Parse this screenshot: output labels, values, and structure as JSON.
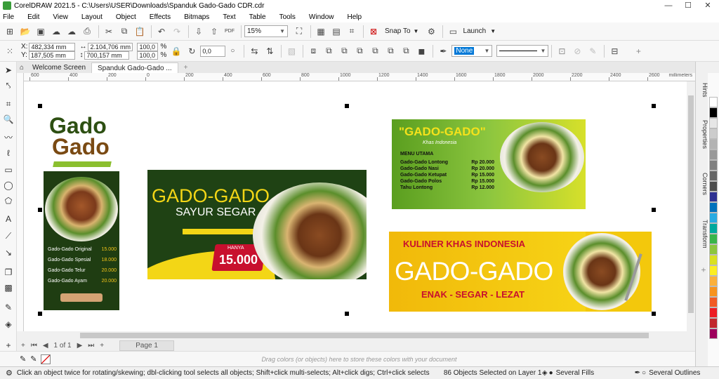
{
  "titlebar": {
    "title": "CorelDRAW 2021.5 - C:\\Users\\USER\\Downloads\\Spanduk Gado-Gado CDR.cdr",
    "min": "—",
    "max": "☐",
    "close": "✕"
  },
  "menu": [
    "File",
    "Edit",
    "View",
    "Layout",
    "Object",
    "Effects",
    "Bitmaps",
    "Text",
    "Table",
    "Tools",
    "Window",
    "Help"
  ],
  "toolbar": {
    "zoom": "15%",
    "snap_to": "Snap To",
    "launch": "Launch",
    "pdf": "PDF"
  },
  "propbar": {
    "x": "482,334 mm",
    "y": "187,505 mm",
    "w": "2.104,706 mm",
    "h": "700,157 mm",
    "scale_x": "100,0",
    "scale_y": "100,0",
    "pct": "%",
    "angle": "0,0",
    "outline": "None"
  },
  "tabs": {
    "welcome": "Welcome Screen",
    "doc": "Spanduk Gado-Gado ...",
    "add": "+"
  },
  "ruler": {
    "unit": "millimeters",
    "labels": [
      "600",
      "400",
      "200",
      "0",
      "200",
      "400",
      "600",
      "800",
      "1000",
      "1200",
      "1400",
      "1600",
      "1800",
      "2000",
      "2200",
      "2400",
      "2600"
    ]
  },
  "pagenav": {
    "count": "1 of 1",
    "page": "Page 1"
  },
  "colorstrip": {
    "hint": "Drag colors (or objects) here to store these colors with your document"
  },
  "status": {
    "hint": "Click an object twice for rotating/skewing; dbl-clicking tool selects all objects; Shift+click multi-selects; Alt+click digs; Ctrl+click selects in a group",
    "selection": "86 Objects Selected on Layer 1",
    "fill": "Several Fills",
    "outline": "Several Outlines"
  },
  "dock": {
    "hints": "Hints",
    "properties": "Properties",
    "corners": "Corners",
    "transform": "Transform"
  },
  "palette": [
    "#ffffff",
    "#000000",
    "#e6e6e6",
    "#cccccc",
    "#b3b3b3",
    "#999999",
    "#808080",
    "#666666",
    "#4d4d4d",
    "#2e3192",
    "#0071bc",
    "#29abe2",
    "#00a99d",
    "#39b54a",
    "#8cc63f",
    "#d9e021",
    "#fcee21",
    "#fbb03b",
    "#f7931e",
    "#f15a24",
    "#ed1c24",
    "#c1272d",
    "#9e005d"
  ],
  "banner1": {
    "title1": "Gado",
    "title2": "Gado",
    "menu": [
      {
        "name": "Gado-Gado Original",
        "price": "15.000"
      },
      {
        "name": "Gado-Gado Spesial",
        "price": "18.000"
      },
      {
        "name": "Gado-Gado Telur",
        "price": "20.000"
      },
      {
        "name": "Gado-Gado Ayam",
        "price": "20.000"
      }
    ]
  },
  "banner2": {
    "title": "GADO-GADO",
    "subtitle": "SAYUR SEGAR",
    "price_label": "HANYA",
    "price": "15.000"
  },
  "banner3": {
    "title": "\"GADO-GADO\"",
    "tagline": "Khas Indonesia",
    "menu_header": "MENU UTAMA",
    "menu": [
      {
        "name": "Gado-Gado Lontong",
        "price": "Rp 20.000"
      },
      {
        "name": "Gado-Gado Nasi",
        "price": "Rp 20.000"
      },
      {
        "name": "Gado-Gado Ketupat",
        "price": "Rp 15.000"
      },
      {
        "name": "Gado-Gado Polos",
        "price": "Rp 15.000"
      },
      {
        "name": "Tahu Lontong",
        "price": "Rp 12.000"
      }
    ]
  },
  "banner4": {
    "top": "KULINER KHAS INDONESIA",
    "title": "GADO-GADO",
    "tagline": "ENAK - SEGAR - LEZAT"
  }
}
